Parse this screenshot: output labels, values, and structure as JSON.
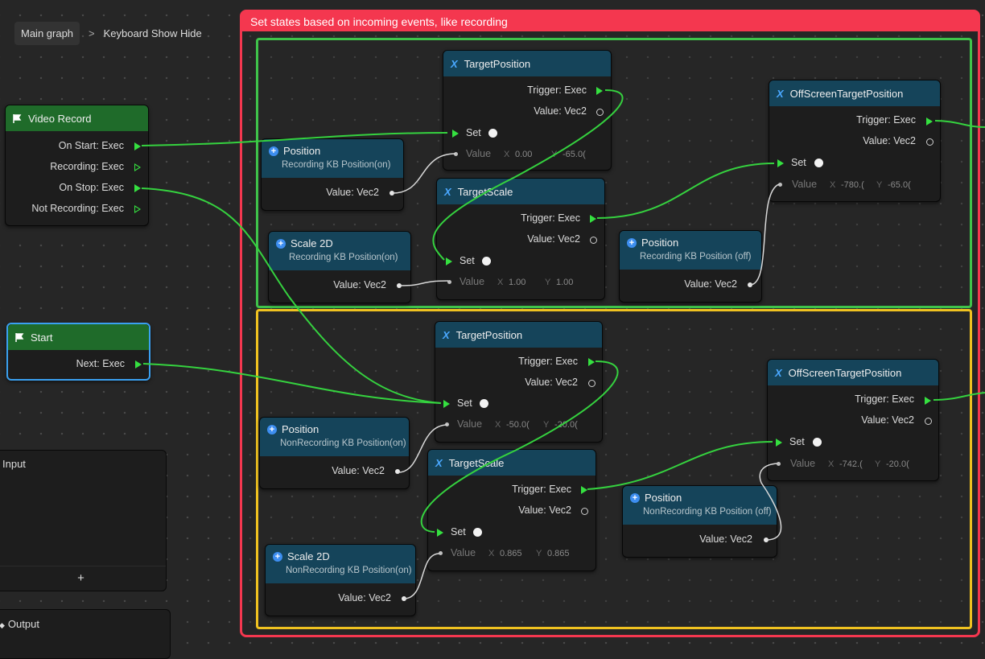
{
  "breadcrumb": {
    "root": "Main graph",
    "separator": ">",
    "current": "Keyboard Show Hide"
  },
  "group_outer": {
    "title": "Set states based on incoming events, like recording",
    "color": "#f4374f"
  },
  "group_colors": {
    "green": "#3fc34a",
    "yellow": "#f0c220"
  },
  "nodes": {
    "video_record": {
      "title": "Video Record",
      "outputs": [
        "On Start: Exec",
        "Recording: Exec",
        "On Stop: Exec",
        "Not Recording: Exec"
      ]
    },
    "start": {
      "title": "Start",
      "outputs": [
        "Next: Exec"
      ]
    },
    "g_target_position": {
      "title": "TargetPosition",
      "trigger": "Trigger: Exec",
      "value": "Value: Vec2",
      "set": "Set",
      "in_label": "Value",
      "x_label": "X",
      "x": "0.00",
      "y_label": "Y",
      "y": "-65.0("
    },
    "g_offscreen": {
      "title": "OffScreenTargetPosition",
      "trigger": "Trigger: Exec",
      "value": "Value: Vec2",
      "set": "Set",
      "in_label": "Value",
      "x_label": "X",
      "x": "-780.(",
      "y_label": "Y",
      "y": "-65.0("
    },
    "g_position_on": {
      "title": "Position",
      "subtitle": "Recording KB Position(on)",
      "value": "Value: Vec2"
    },
    "g_target_scale": {
      "title": "TargetScale",
      "trigger": "Trigger: Exec",
      "value": "Value: Vec2",
      "set": "Set",
      "in_label": "Value",
      "x_label": "X",
      "x": "1.00",
      "y_label": "Y",
      "y": "1.00"
    },
    "g_scale2d": {
      "title": "Scale 2D",
      "subtitle": "Recording KB Position(on)",
      "value": "Value: Vec2"
    },
    "g_position_off": {
      "title": "Position",
      "subtitle": "Recording KB Position (off)",
      "value": "Value: Vec2"
    },
    "y_target_position": {
      "title": "TargetPosition",
      "trigger": "Trigger: Exec",
      "value": "Value: Vec2",
      "set": "Set",
      "in_label": "Value",
      "x_label": "X",
      "x": "-50.0(",
      "y_label": "Y",
      "y": "-20.0("
    },
    "y_offscreen": {
      "title": "OffScreenTargetPosition",
      "trigger": "Trigger: Exec",
      "value": "Value: Vec2",
      "set": "Set",
      "in_label": "Value",
      "x_label": "X",
      "x": "-742.(",
      "y_label": "Y",
      "y": "-20.0("
    },
    "y_position_on": {
      "title": "Position",
      "subtitle": "NonRecording KB Position(on)",
      "value": "Value: Vec2"
    },
    "y_target_scale": {
      "title": "TargetScale",
      "trigger": "Trigger: Exec",
      "value": "Value: Vec2",
      "set": "Set",
      "in_label": "Value",
      "x_label": "X",
      "x": "0.865",
      "y_label": "Y",
      "y": "0.865"
    },
    "y_position_off": {
      "title": "Position",
      "subtitle": "NonRecording KB Position (off)",
      "value": "Value: Vec2"
    },
    "y_scale2d": {
      "title": "Scale 2D",
      "subtitle": "NonRecording KB Position(on)",
      "value": "Value: Vec2"
    }
  },
  "input_panel": {
    "title": "Input",
    "add": "+"
  },
  "output_panel": {
    "title": "Output"
  },
  "colors": {
    "exec_wire": "#35d23f",
    "value_wire": "#d8d8d8",
    "event_header": "#1f6b2a",
    "variable_header": "#15445a"
  }
}
